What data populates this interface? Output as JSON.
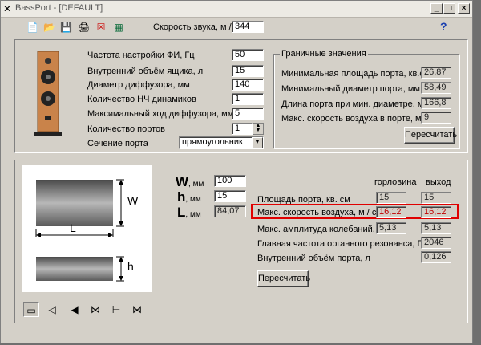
{
  "window": {
    "title": "BassPort - [DEFAULT]",
    "min_glyph": "_",
    "max_glyph": "□",
    "close_glyph": "×",
    "help_glyph": "?"
  },
  "bg_tab": "Do",
  "toolbar": {
    "sound_speed_label": "Скорость звука, м /с",
    "sound_speed_value": "344"
  },
  "params": [
    {
      "label": "Частота настройки ФИ, Гц",
      "value": "50"
    },
    {
      "label": "Внутренний объём ящика, л",
      "value": "15"
    },
    {
      "label": "Диаметр диффузора, мм",
      "value": "140"
    },
    {
      "label": "Количество НЧ динамиков",
      "value": "1"
    },
    {
      "label": "Максимальный ход диффузора, мм",
      "value": "5"
    },
    {
      "label": "Количество портов",
      "value": "1"
    }
  ],
  "section": {
    "label": "Сечение порта",
    "selected": "прямоугольник"
  },
  "limits": {
    "title": "Граничные значения",
    "rows": [
      {
        "label": "Минимальная площадь порта, кв.см.",
        "value": "26,87"
      },
      {
        "label": "Минимальный диаметр порта, мм",
        "value": "58,49"
      },
      {
        "label": "Длина порта при мин. диаметре, мм",
        "value": "166,8"
      },
      {
        "label": "Макс. скорость воздуха в порте, м /с",
        "value": "9"
      }
    ],
    "recalc_label": "Пересчитать"
  },
  "diagram": {
    "w_label": "W",
    "l_label": "L",
    "h_label": "h"
  },
  "dims": {
    "unit": ", мм",
    "w_letter": "W",
    "h_letter": "h",
    "l_letter": "L",
    "w_value": "100",
    "h_value": "15",
    "l_value": "84,07"
  },
  "results": {
    "col_throat": "горловина",
    "col_exit": "выход",
    "rows": [
      {
        "label": "Площадь порта, кв. см",
        "throat": "15",
        "exit": "15"
      },
      {
        "label": "Макс. скорость воздуха, м / с",
        "throat": "16,12",
        "exit": "16,12"
      },
      {
        "label": "Макс. амплитуда колебаний, см",
        "throat": "5,13",
        "exit": "5,13"
      },
      {
        "label": "Главная частота органного резонанса, Гц",
        "throat": "",
        "exit": "2046"
      },
      {
        "label": "Внутренний объём порта, л",
        "throat": "",
        "exit": "0,126"
      }
    ],
    "recalc_label": "Пересчитать"
  },
  "colors": {
    "highlight": "#e00000",
    "red_value": "#c00000"
  }
}
